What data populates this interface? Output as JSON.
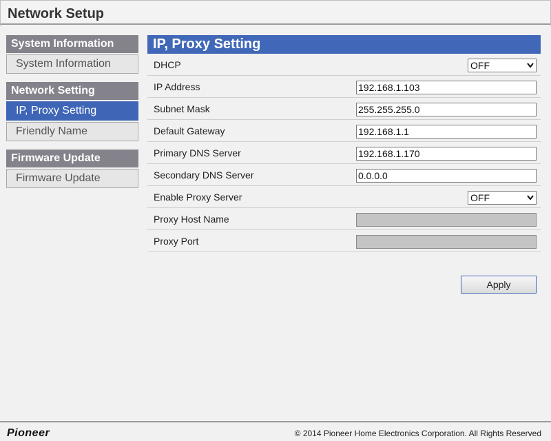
{
  "header": {
    "title": "Network Setup"
  },
  "sidebar": {
    "groups": [
      {
        "heading": "System Information",
        "items": [
          {
            "label": "System Information"
          }
        ]
      },
      {
        "heading": "Network Setting",
        "items": [
          {
            "label": "IP, Proxy Setting"
          },
          {
            "label": "Friendly Name"
          }
        ]
      },
      {
        "heading": "Firmware Update",
        "items": [
          {
            "label": "Firmware Update"
          }
        ]
      }
    ]
  },
  "panel": {
    "title": "IP, Proxy Setting",
    "fields": {
      "dhcp": {
        "label": "DHCP",
        "value": "OFF"
      },
      "ip_address": {
        "label": "IP Address",
        "value": "192.168.1.103"
      },
      "subnet_mask": {
        "label": "Subnet Mask",
        "value": "255.255.255.0"
      },
      "default_gateway": {
        "label": "Default Gateway",
        "value": "192.168.1.1"
      },
      "primary_dns": {
        "label": "Primary DNS Server",
        "value": "192.168.1.170"
      },
      "secondary_dns": {
        "label": "Secondary DNS Server",
        "value": "0.0.0.0"
      },
      "enable_proxy": {
        "label": "Enable Proxy Server",
        "value": "OFF"
      },
      "proxy_host": {
        "label": "Proxy Host Name",
        "value": ""
      },
      "proxy_port": {
        "label": "Proxy Port",
        "value": ""
      }
    },
    "apply_label": "Apply"
  },
  "footer": {
    "logo": "Pioneer",
    "copyright": "© 2014 Pioneer Home Electronics Corporation. All Rights Reserved"
  },
  "colors": {
    "accent": "#4168b8",
    "sidebar_heading": "#84828a"
  },
  "icons": {
    "select_arrow": "chevron-down-icon"
  }
}
